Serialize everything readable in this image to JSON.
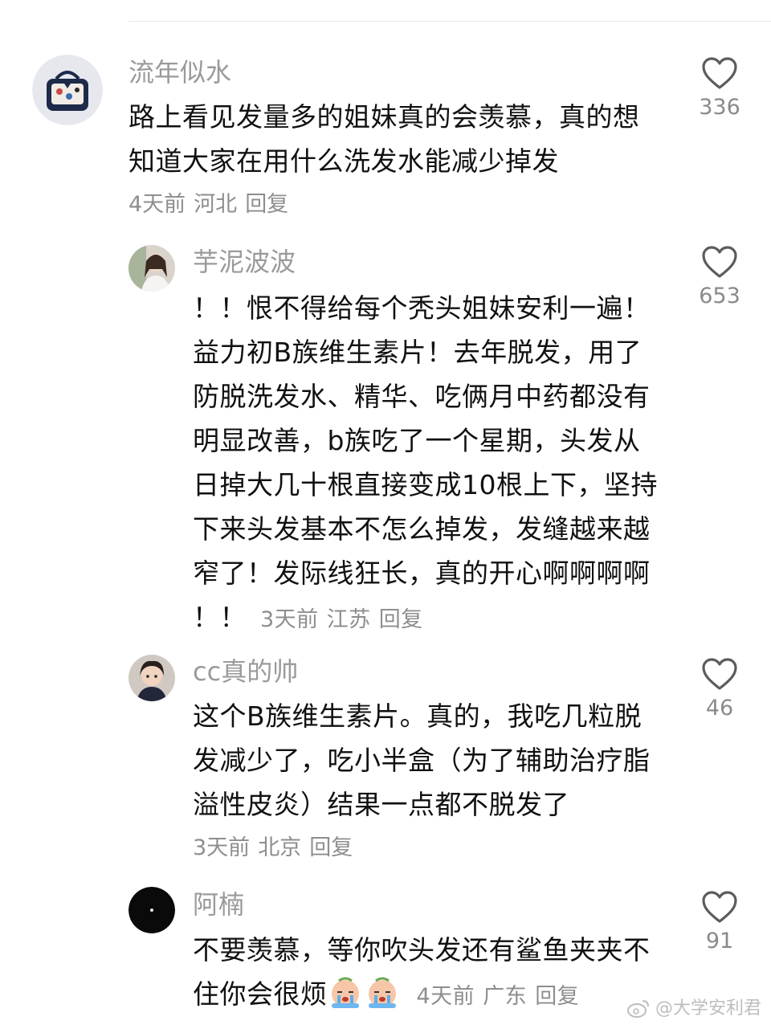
{
  "comments": [
    {
      "username": "流年似水",
      "lines": [
        "路上看见发量多的姐妹真的会羡慕，真的想",
        "知道大家在用什么洗发水能减少掉发"
      ],
      "time": "4天前",
      "location": "河北",
      "reply_label": "回复",
      "likes": "336",
      "avatar_icon": "bag-avatar-icon"
    },
    {
      "username": "芋泥波波",
      "lines": [
        "！！恨不得给每个秃头姐妹安利一遍！",
        "益力初B族维生素片！去年脱发，用了",
        "防脱洗发水、精华、吃俩月中药都没有",
        "明显改善，b族吃了一个星期，头发从",
        "日掉大几十根直接变成10根上下，坚持",
        "下来头发基本不怎么掉发，发缝越来越",
        "窄了！发际线狂长，真的开心啊啊啊啊"
      ],
      "last_line_prefix": "！！",
      "time": "3天前",
      "location": "江苏",
      "reply_label": "回复",
      "likes": "653",
      "avatar_icon": "portrait-avatar-icon"
    },
    {
      "username": "cc真的帅",
      "lines": [
        "这个B族维生素片。真的，我吃几粒脱",
        "发减少了，吃小半盒（为了辅助治疗脂",
        "溢性皮炎）结果一点都不脱发了"
      ],
      "time": "3天前",
      "location": "北京",
      "reply_label": "回复",
      "likes": "46",
      "avatar_icon": "child-avatar-icon"
    },
    {
      "username": "阿楠",
      "lines": [
        "不要羡慕，等你吹头发还有鲨鱼夹夹不"
      ],
      "last_line_prefix": "住你会很烦",
      "time": "4天前",
      "location": "广东",
      "reply_label": "回复",
      "likes": "91",
      "avatar_icon": "dark-avatar-icon",
      "emojis": [
        "crying-emoji-icon",
        "crying-emoji-icon"
      ]
    }
  ],
  "watermark": "@大学安利君",
  "colors": {
    "username": "#9a9a9a",
    "meta": "#8e8e8e",
    "content": "#111111",
    "like_icon": "#5c5c5c"
  }
}
